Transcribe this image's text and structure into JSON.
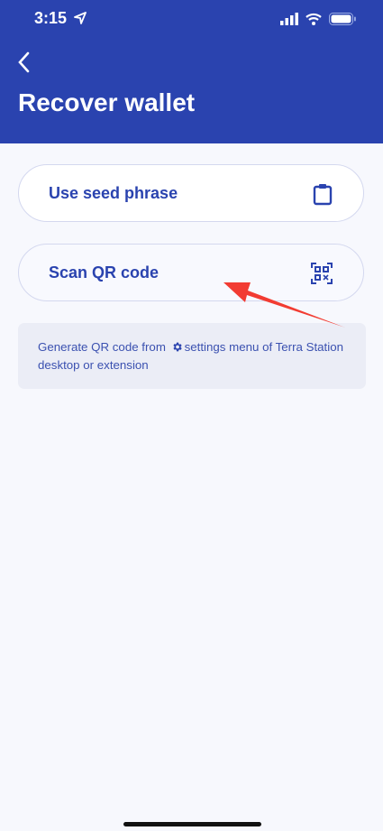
{
  "status_bar": {
    "time": "3:15"
  },
  "header": {
    "title": "Recover wallet"
  },
  "options": [
    {
      "label": "Use seed phrase",
      "icon": "clipboard-icon"
    },
    {
      "label": "Scan QR code",
      "icon": "qr-code-icon"
    }
  ],
  "info": {
    "text_before": "Generate QR code from ",
    "text_after": "settings menu of Terra Station desktop or extension"
  },
  "colors": {
    "brand": "#2a43af",
    "background": "#f7f8fd",
    "annotation": "#f23c32"
  }
}
